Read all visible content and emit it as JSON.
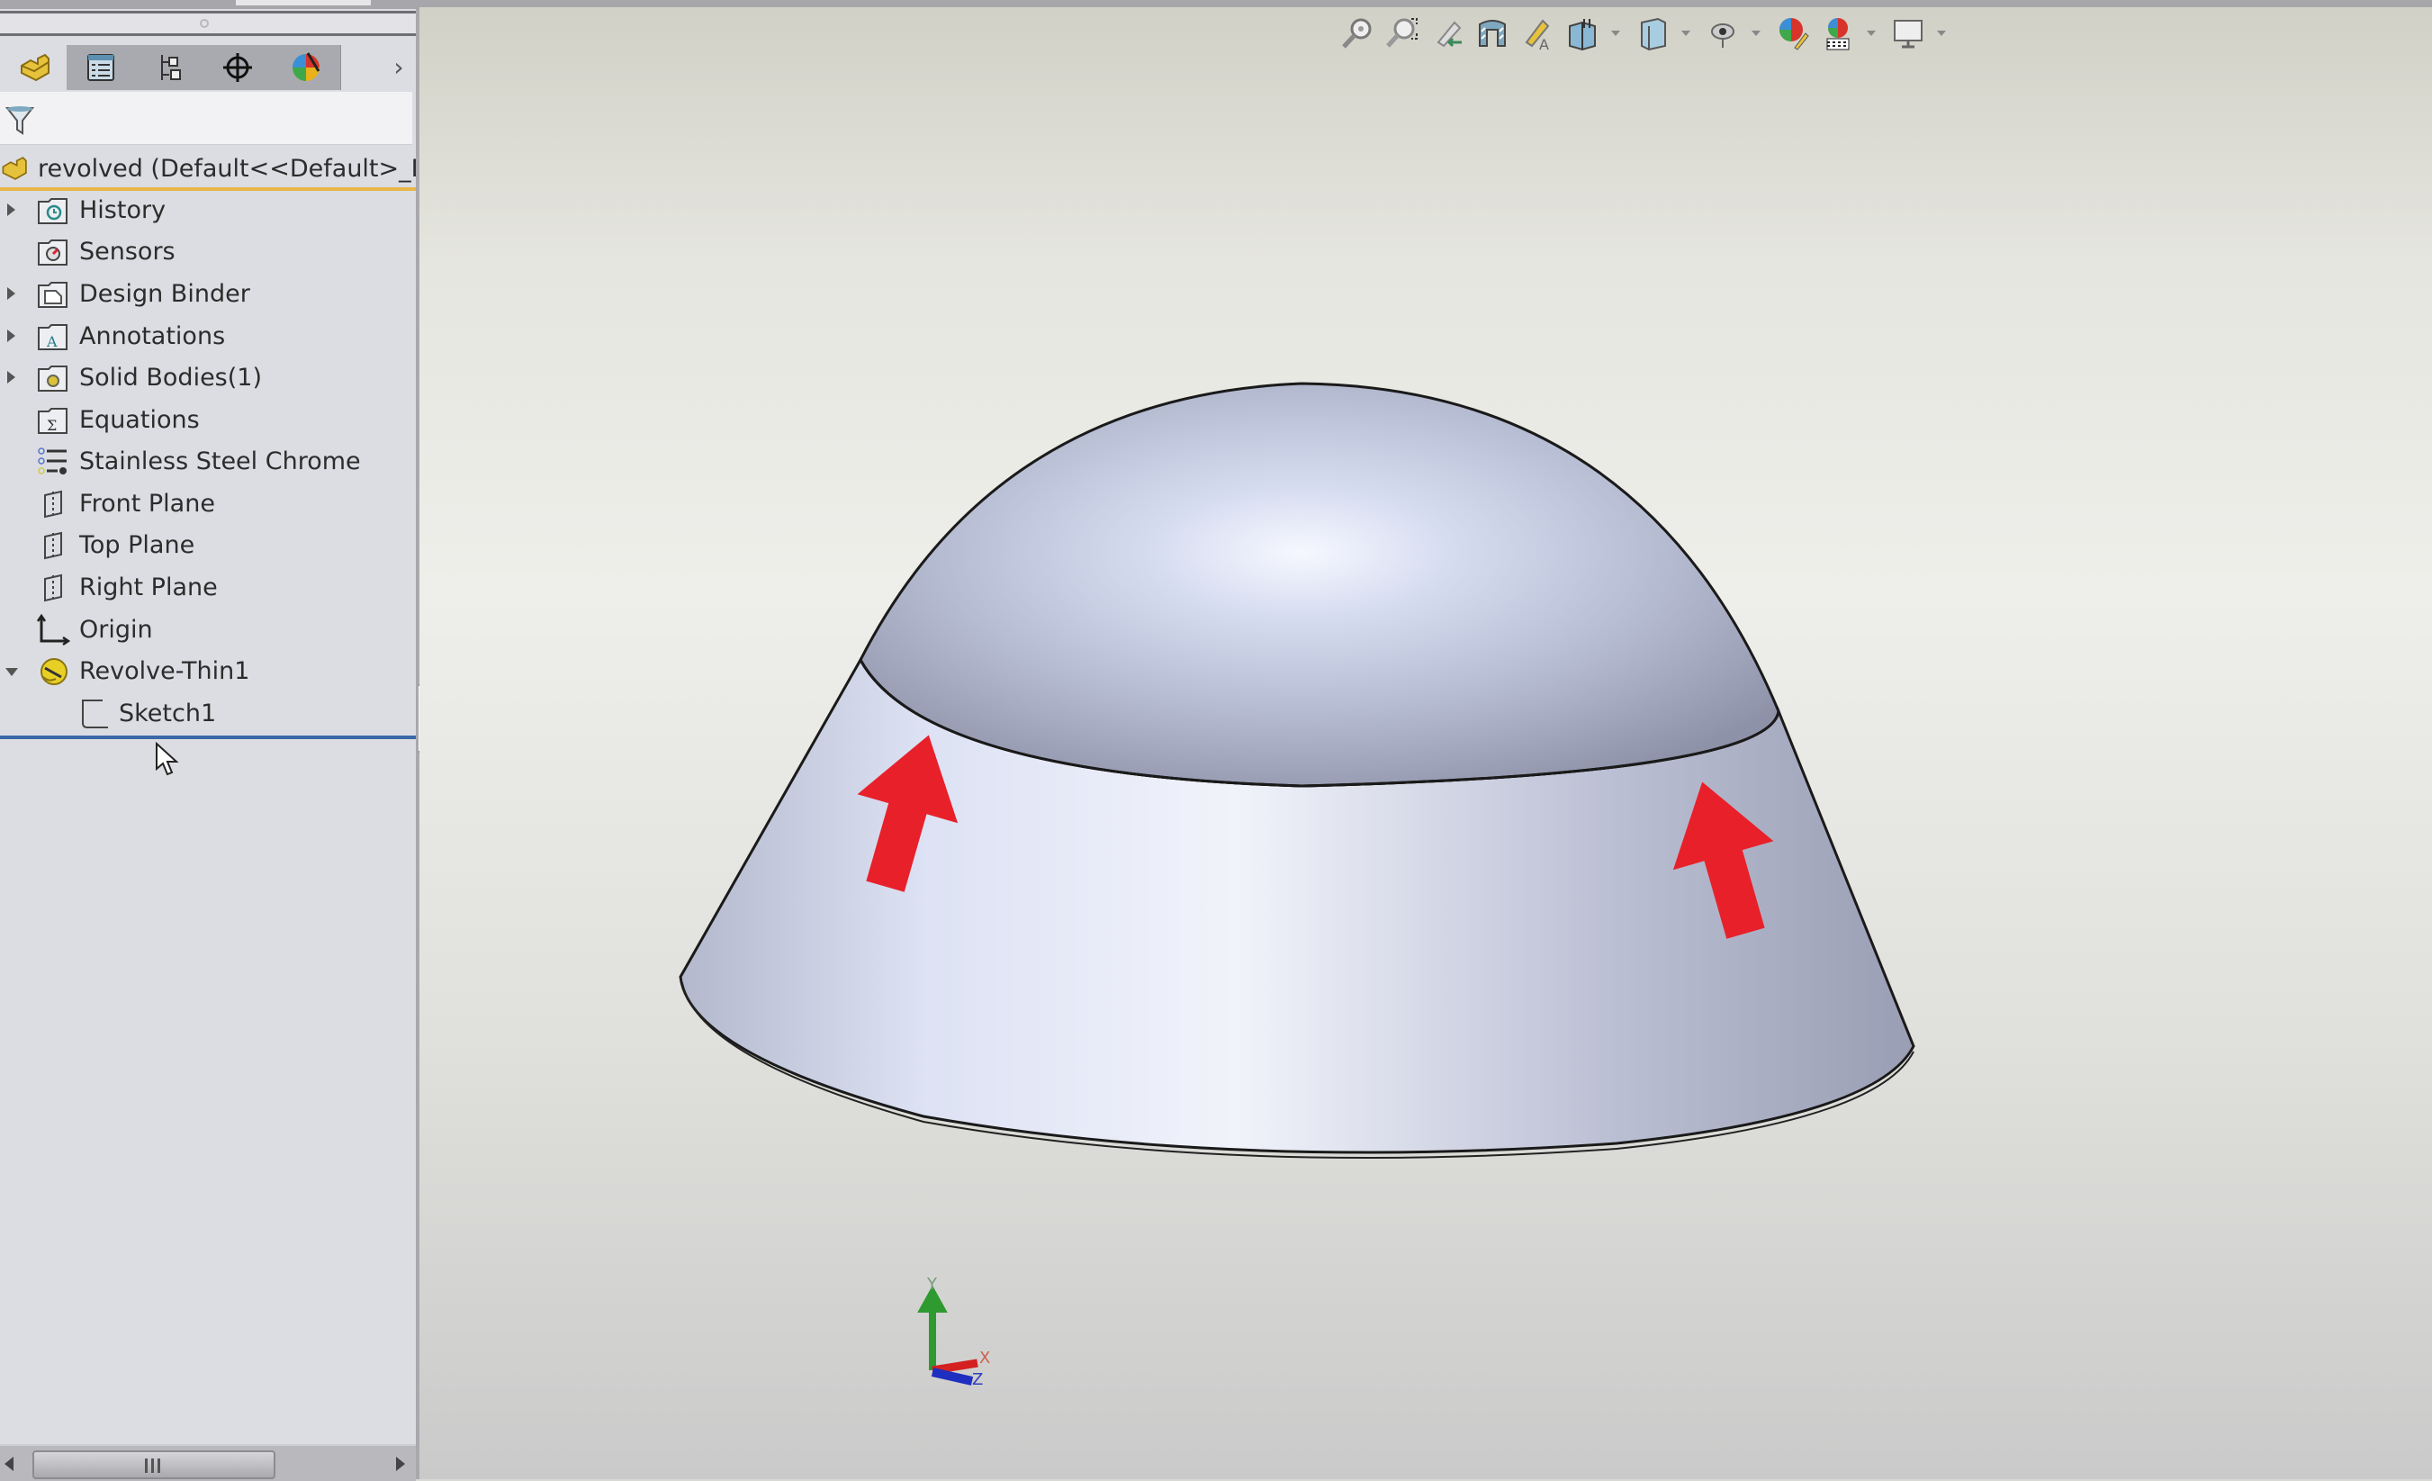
{
  "feature_manager": {
    "panel_tabs": [
      {
        "name": "FeatureManager Design Tree",
        "icon": "part-icon",
        "active": true
      },
      {
        "name": "PropertyManager",
        "icon": "property-manager-icon",
        "active": false
      },
      {
        "name": "ConfigurationManager",
        "icon": "configuration-manager-icon",
        "active": false
      },
      {
        "name": "DimXpertManager",
        "icon": "dimxpert-icon",
        "active": false
      },
      {
        "name": "DisplayManager",
        "icon": "display-manager-icon",
        "active": false
      }
    ],
    "more_tabs_glyph": "›",
    "filter_icon": "filter-icon",
    "root": {
      "label": "revolved  (Default<<Default>_D",
      "icon": "part-icon"
    },
    "tree_items": [
      {
        "label": "History",
        "icon": "history-folder-icon",
        "expandable": true,
        "expanded": false
      },
      {
        "label": "Sensors",
        "icon": "sensors-folder-icon",
        "expandable": false
      },
      {
        "label": "Design Binder",
        "icon": "design-binder-folder-icon",
        "expandable": true,
        "expanded": false
      },
      {
        "label": "Annotations",
        "icon": "annotations-folder-icon",
        "expandable": true,
        "expanded": false
      },
      {
        "label": "Solid Bodies(1)",
        "icon": "solid-bodies-folder-icon",
        "expandable": true,
        "expanded": false
      },
      {
        "label": "Equations",
        "icon": "equations-folder-icon",
        "expandable": false
      },
      {
        "label": "Stainless Steel Chrome",
        "icon": "material-icon",
        "expandable": false
      },
      {
        "label": "Front Plane",
        "icon": "plane-icon",
        "expandable": false
      },
      {
        "label": "Top Plane",
        "icon": "plane-icon",
        "expandable": false
      },
      {
        "label": "Right Plane",
        "icon": "plane-icon",
        "expandable": false
      },
      {
        "label": "Origin",
        "icon": "origin-icon",
        "expandable": false
      },
      {
        "label": "Revolve-Thin1",
        "icon": "revolve-thin-icon",
        "expandable": true,
        "expanded": true
      },
      {
        "label": "Sketch1",
        "icon": "sketch-icon",
        "expandable": false,
        "child": true
      }
    ]
  },
  "heads_up_toolbar": [
    {
      "name": "Zoom to Fit",
      "icon": "zoom-to-fit-icon"
    },
    {
      "name": "Zoom to Area",
      "icon": "zoom-to-area-icon"
    },
    {
      "name": "Previous View",
      "icon": "previous-view-icon"
    },
    {
      "name": "Section View",
      "icon": "section-view-icon"
    },
    {
      "name": "Dynamic Annotation Views",
      "icon": "dynamic-annotation-icon"
    },
    {
      "name": "View Orientation",
      "icon": "view-orientation-icon",
      "dropdown": true
    },
    {
      "name": "Display Style",
      "icon": "display-style-icon",
      "dropdown": true
    },
    {
      "name": "Hide/Show Items",
      "icon": "hide-show-icon",
      "dropdown": true
    },
    {
      "name": "Edit Appearance",
      "icon": "edit-appearance-icon"
    },
    {
      "name": "Apply Scene",
      "icon": "apply-scene-icon",
      "dropdown": true
    },
    {
      "name": "View Settings",
      "icon": "view-settings-icon",
      "dropdown": true
    }
  ],
  "viewport": {
    "model_name": "revolved",
    "annotation_arrow_color": "#e8202a",
    "triad_axes": [
      "Y",
      "X",
      "Z"
    ]
  },
  "colors": {
    "root_underline": "#e8b547",
    "insert_line": "#3b67a8",
    "axis_x": "#d42020",
    "axis_y": "#2f9a2f",
    "axis_z": "#1f2fbf"
  }
}
